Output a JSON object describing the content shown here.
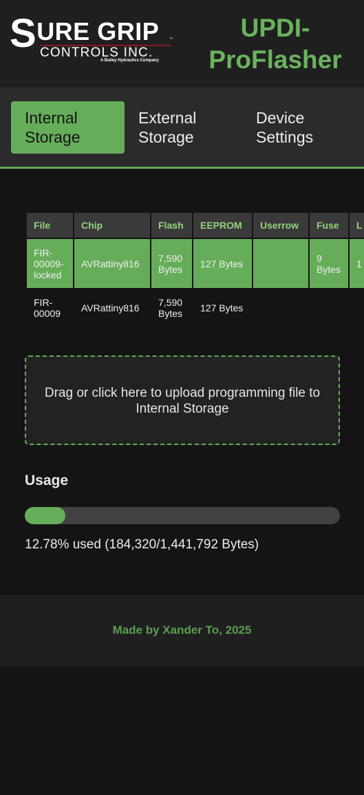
{
  "header": {
    "logo": {
      "brand_s": "S",
      "brand_rest": "URE GRIP",
      "trademark": "™",
      "controls": "CONTROLS INC.",
      "subtitle": "A Bailey Hydraulics Company"
    },
    "title": "UPDI-ProFlasher"
  },
  "nav": {
    "tabs": [
      {
        "label": "Internal Storage",
        "active": true
      },
      {
        "label": "External Storage",
        "active": false
      },
      {
        "label": "Device Settings",
        "active": false
      }
    ]
  },
  "table": {
    "columns": [
      "File",
      "Chip",
      "Flash",
      "EEPROM",
      "Userrow",
      "Fuse",
      "L"
    ],
    "rows": [
      {
        "file": "FIR-00009-locked",
        "chip": "AVRattiny816",
        "flash": "7,590 Bytes",
        "eeprom": "127 Bytes",
        "userrow": "",
        "fuse": "9 Bytes",
        "extra": "1",
        "selected": true
      },
      {
        "file": "FIR-00009",
        "chip": "AVRattiny816",
        "flash": "7,590 Bytes",
        "eeprom": "127 Bytes",
        "userrow": "",
        "fuse": "",
        "extra": "",
        "selected": false
      }
    ]
  },
  "upload": {
    "text": "Drag or click here to upload programming file to Internal Storage"
  },
  "usage": {
    "heading": "Usage",
    "percent": 12.78,
    "text": "12.78% used (184,320/1,441,792 Bytes)"
  },
  "footer": {
    "text": "Made by Xander To, 2025"
  },
  "colors": {
    "accent": "#66ad5a",
    "title": "#6ab35e",
    "header_text": "#95d37f",
    "background": "#141414"
  }
}
